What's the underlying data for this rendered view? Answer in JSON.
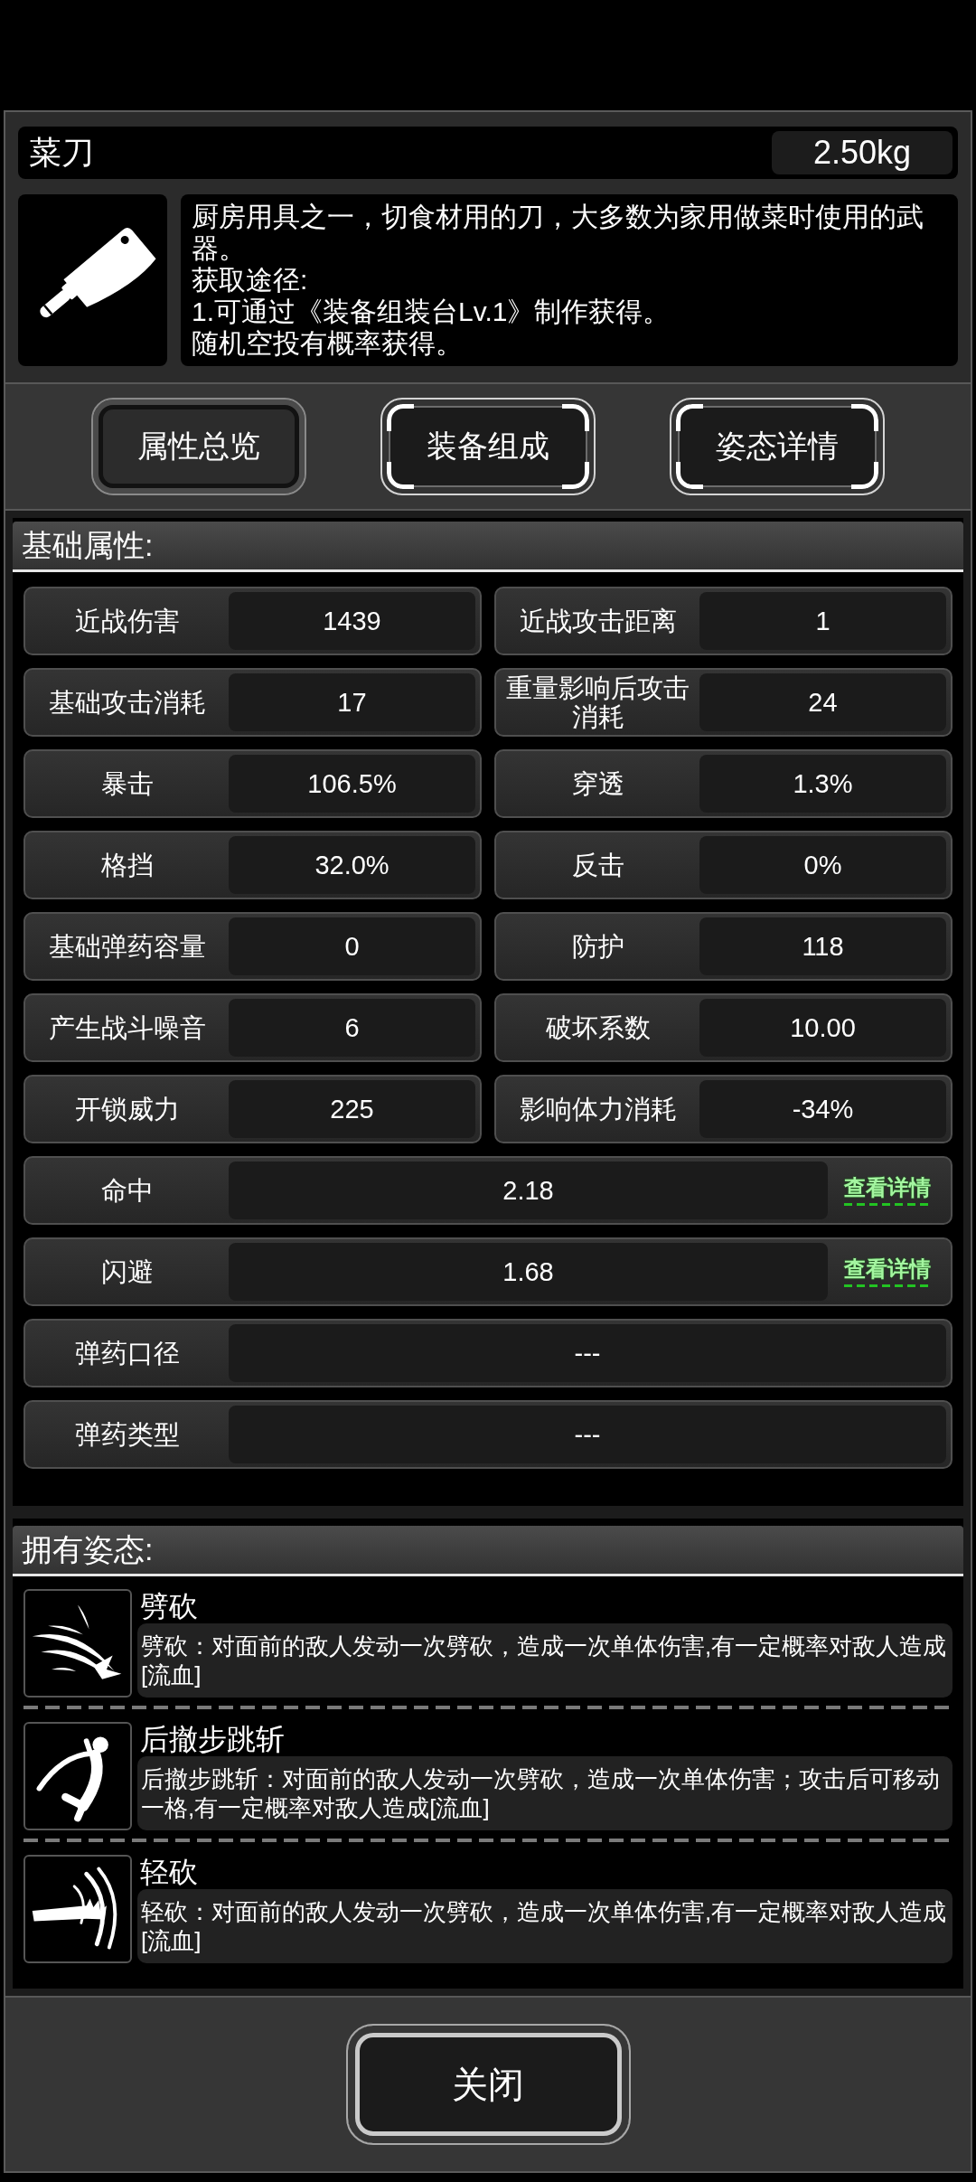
{
  "item": {
    "name": "菜刀",
    "weight": "2.50kg",
    "description": [
      "厨房用具之一，切食材用的刀，大多数为家用做菜时使用的武器。",
      "获取途径:",
      "1.可通过《装备组装台Lv.1》制作获得。",
      "随机空投有概率获得。"
    ]
  },
  "tabs": [
    {
      "label": "属性总览",
      "selected": true
    },
    {
      "label": "装备组成",
      "selected": false
    },
    {
      "label": "姿态详情",
      "selected": false
    }
  ],
  "basic_attributes": {
    "title": "基础属性:",
    "stats": [
      {
        "kind": "half",
        "label": "近战伤害",
        "value": "1439"
      },
      {
        "kind": "half",
        "label": "近战攻击距离",
        "value": "1"
      },
      {
        "kind": "half",
        "label": "基础攻击消耗",
        "value": "17"
      },
      {
        "kind": "half",
        "label": "重量影响后攻击消耗",
        "value": "24"
      },
      {
        "kind": "half",
        "label": "暴击",
        "value": "106.5%"
      },
      {
        "kind": "half",
        "label": "穿透",
        "value": "1.3%"
      },
      {
        "kind": "half",
        "label": "格挡",
        "value": "32.0%"
      },
      {
        "kind": "half",
        "label": "反击",
        "value": "0%"
      },
      {
        "kind": "half",
        "label": "基础弹药容量",
        "value": "0"
      },
      {
        "kind": "half",
        "label": "防护",
        "value": "118"
      },
      {
        "kind": "half",
        "label": "产生战斗噪音",
        "value": "6"
      },
      {
        "kind": "half",
        "label": "破坏系数",
        "value": "10.00"
      },
      {
        "kind": "half",
        "label": "开锁威力",
        "value": "225"
      },
      {
        "kind": "half",
        "label": "影响体力消耗",
        "value": "-34%"
      },
      {
        "kind": "full",
        "label": "命中",
        "value": "2.18",
        "link": "查看详情"
      },
      {
        "kind": "full",
        "label": "闪避",
        "value": "1.68",
        "link": "查看详情"
      },
      {
        "kind": "full",
        "label": "弹药口径",
        "value": "---"
      },
      {
        "kind": "full",
        "label": "弹药类型",
        "value": "---"
      }
    ]
  },
  "stances": {
    "title": "拥有姿态:",
    "items": [
      {
        "name": "劈砍",
        "description": "劈砍：对面前的敌人发动一次劈砍，造成一次单体伤害,有一定概率对敌人造成[流血]"
      },
      {
        "name": "后撤步跳斩",
        "description": "后撤步跳斩：对面前的敌人发动一次劈砍，造成一次单体伤害；攻击后可移动一格,有一定概率对敌人造成[流血]"
      },
      {
        "name": "轻砍",
        "description": "轻砍：对面前的敌人发动一次劈砍，造成一次单体伤害,有一定概率对敌人造成[流血]"
      }
    ]
  },
  "close_button": "关闭"
}
